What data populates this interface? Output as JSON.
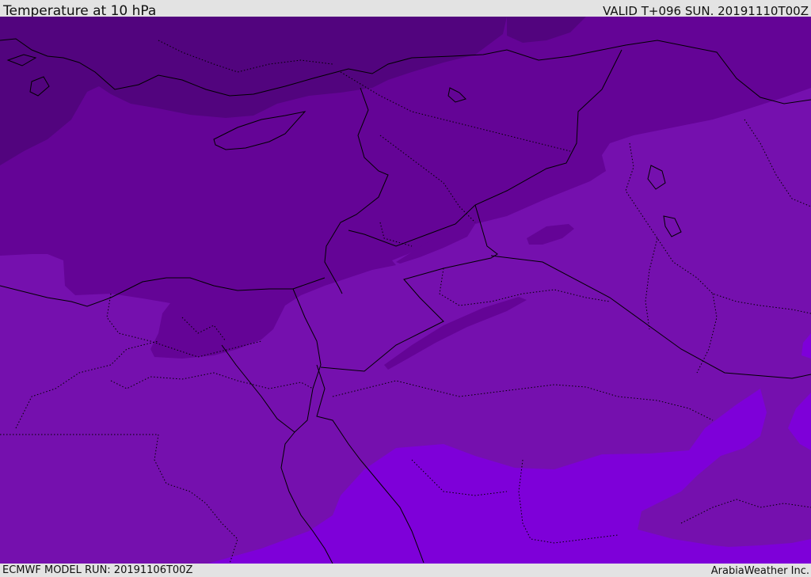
{
  "header": {
    "title": "Temperature at 10 hPa",
    "valid_time": "VALID T+096 SUN. 20191110T00Z"
  },
  "footer": {
    "model_run": "ECMWF MODEL RUN: 20191106T00Z",
    "credit": "ArabiaWeather Inc."
  },
  "colors": {
    "band_darkest": "#52047e",
    "band_dark": "#640496",
    "band_mid": "#7510ae",
    "band_light": "#7e00d9",
    "border_line": "#000000"
  }
}
